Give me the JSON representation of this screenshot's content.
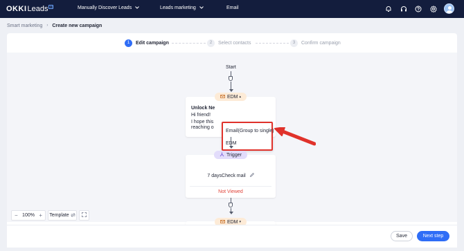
{
  "brand": {
    "name_primary": "OKKI",
    "name_secondary": "Leads",
    "badge": "AI"
  },
  "topnav": {
    "items": [
      {
        "label": "Manually Discover Leads",
        "has_dropdown": true
      },
      {
        "label": "Leads marketing",
        "has_dropdown": true
      },
      {
        "label": "Email",
        "has_dropdown": false
      }
    ],
    "icons": [
      "bell-icon",
      "headset-icon",
      "help-icon",
      "settings-icon",
      "user-avatar"
    ]
  },
  "breadcrumb": {
    "root": "Smart marketing",
    "separator": "›",
    "current": "Create new campaign"
  },
  "steps": [
    {
      "number": "1",
      "label": "Edit campaign",
      "state": "active"
    },
    {
      "number": "2",
      "label": "Select contacts",
      "state": "inactive"
    },
    {
      "number": "3",
      "label": "Confirm campaign",
      "state": "inactive"
    }
  ],
  "flow": {
    "start_label": "Start",
    "edm_node": {
      "pill_label": "EDM",
      "pill_caret": "▴",
      "title": "Unlock Ne",
      "lines": [
        "Hi friend!",
        "I hope this",
        "reaching o"
      ]
    },
    "dropdown": {
      "options": [
        "Email(Group to single)",
        "EDM"
      ]
    },
    "trigger_node": {
      "pill_label": "Trigger",
      "condition": "7 daysCheck mail",
      "status": "Not Viewed"
    },
    "edm_node_2": {
      "pill_label": "EDM",
      "pill_caret": "▾"
    }
  },
  "controls": {
    "zoom": "100%",
    "zoom_out": "−",
    "zoom_in": "+",
    "template_label": "Template"
  },
  "footer": {
    "save_label": "Save",
    "next_label": "Next step"
  },
  "colors": {
    "nav_bg": "#131d3d",
    "primary": "#2f6df6",
    "highlight": "#e0322b",
    "not_viewed": "#e0443a",
    "edm_pill": "#fdebd7",
    "trigger_pill": "#e2dcfb"
  }
}
